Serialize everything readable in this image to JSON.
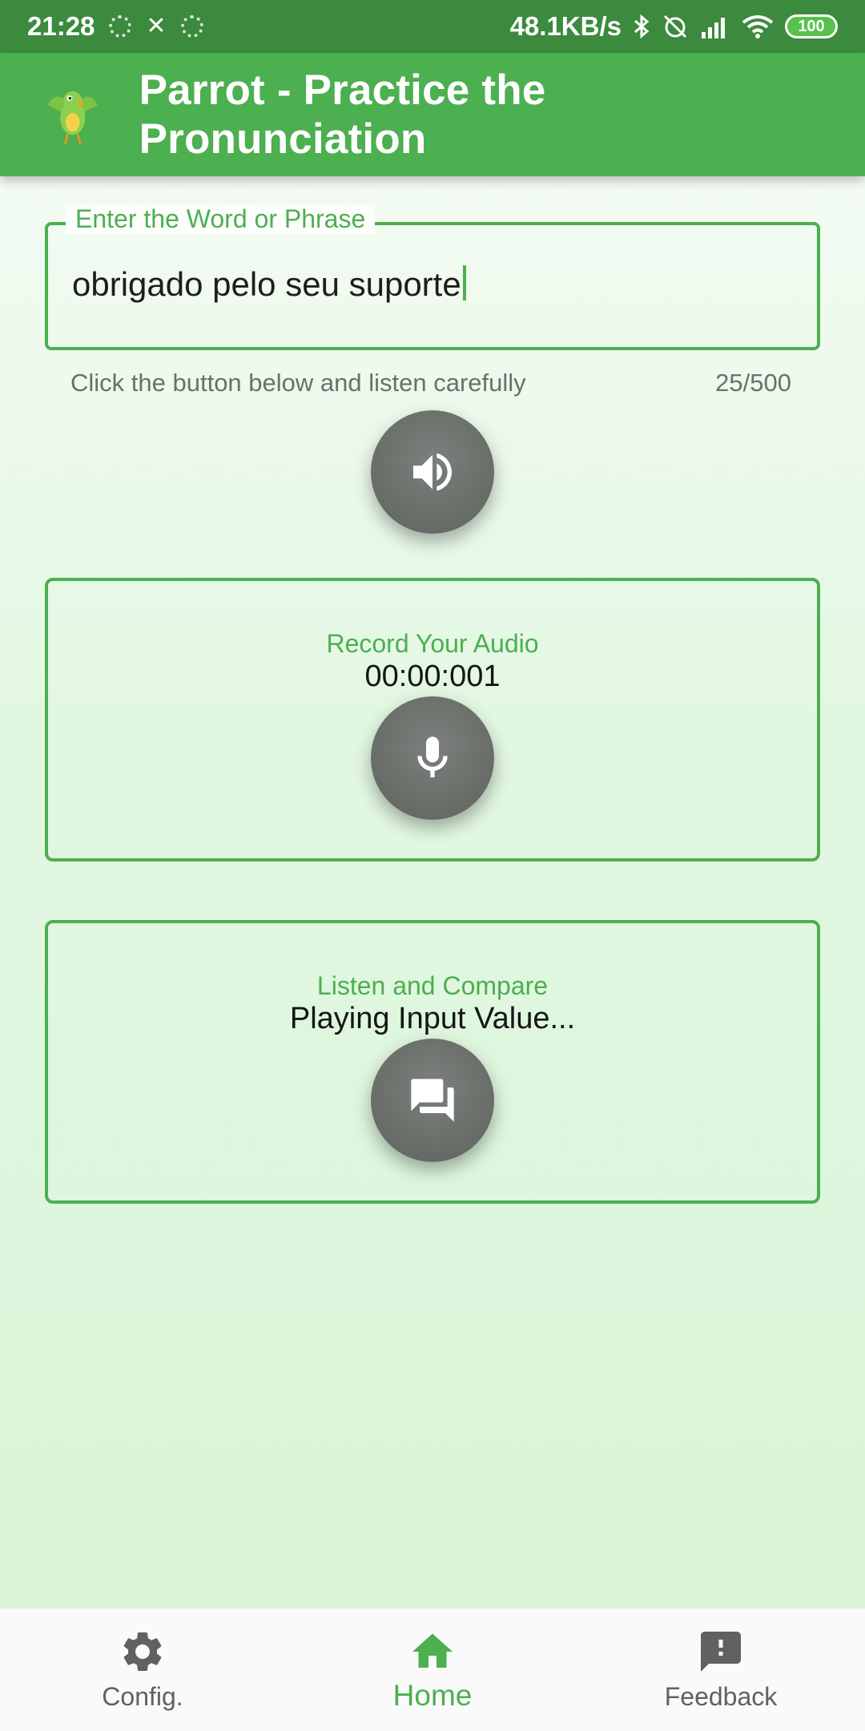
{
  "status_bar": {
    "time": "21:28",
    "net_speed": "48.1KB/s",
    "battery": "100",
    "icons": [
      "notification-dot-icon",
      "butterfly-icon",
      "notification-dot-icon",
      "bluetooth-icon",
      "alarm-off-icon",
      "signal-icon",
      "wifi-icon",
      "battery-icon"
    ]
  },
  "app_bar": {
    "title": "Parrot - Practice the Pronunciation",
    "logo_icon": "parrot-logo-icon"
  },
  "input": {
    "label": "Enter the Word or Phrase",
    "value": "obrigado pelo seu suporte",
    "helper": "Click the button below and listen carefully",
    "counter": "25/500"
  },
  "listen_button": {
    "icon": "speaker-icon"
  },
  "record_card": {
    "title": "Record Your Audio",
    "timer": "00:00:001",
    "icon": "microphone-icon"
  },
  "compare_card": {
    "title": "Listen and Compare",
    "status": "Playing Input Value...",
    "icon": "chat-bubbles-icon"
  },
  "bottom_nav": {
    "items": [
      {
        "label": "Config.",
        "icon": "gear-icon",
        "active": false
      },
      {
        "label": "Home",
        "icon": "home-icon",
        "active": true
      },
      {
        "label": "Feedback",
        "icon": "feedback-icon",
        "active": false
      }
    ]
  },
  "colors": {
    "primary": "#4caf50",
    "status_bar": "#3b8a3d",
    "button_grey": "#646964",
    "inactive_nav": "#616161"
  }
}
